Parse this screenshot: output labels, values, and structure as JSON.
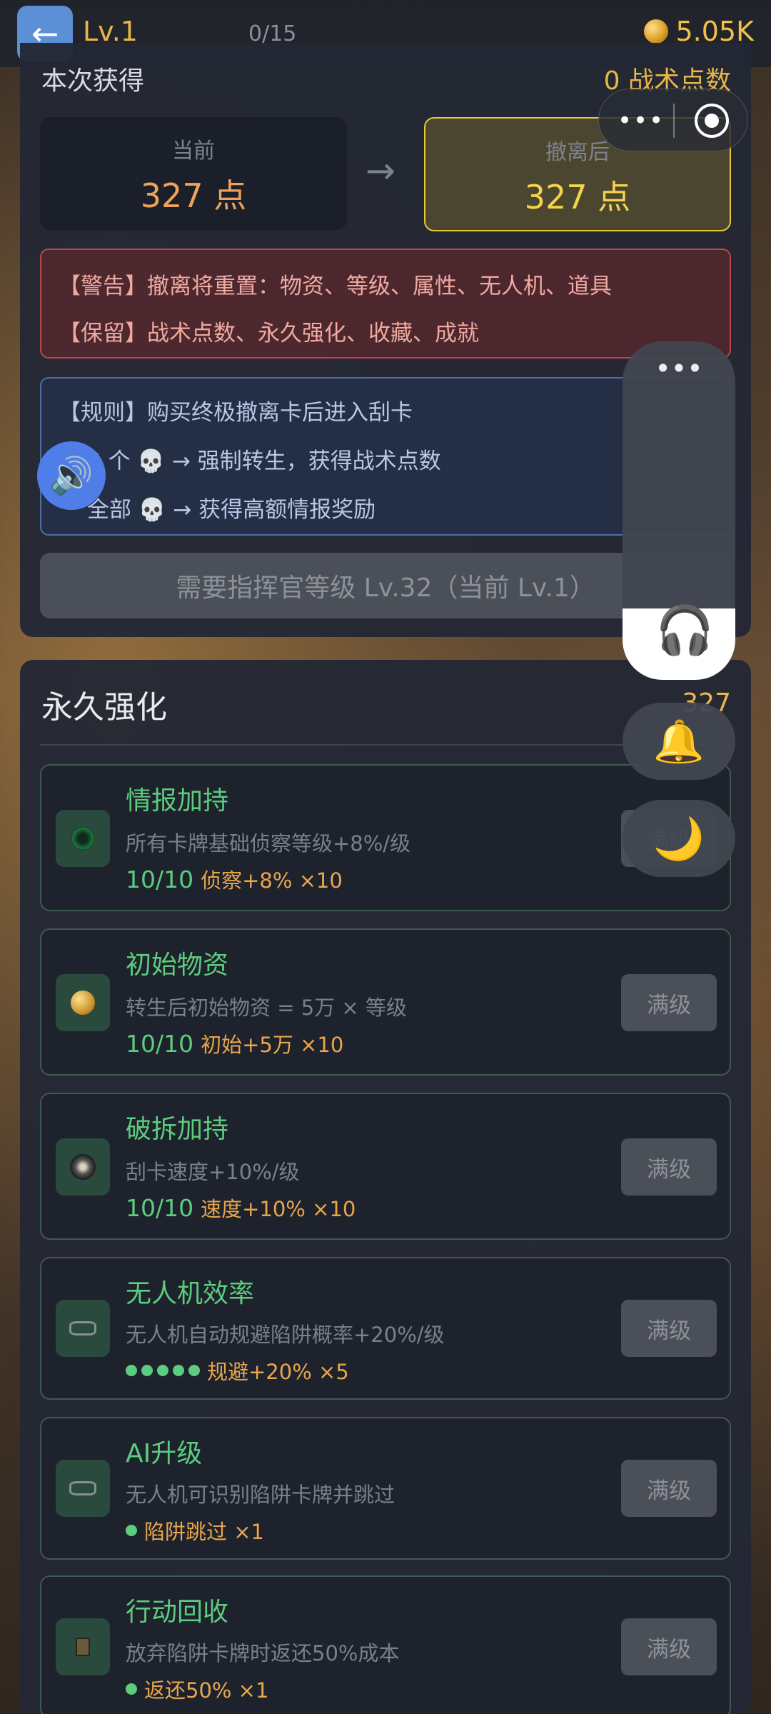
{
  "topbar": {
    "back_icon": "arrow-left-icon",
    "level": "Lv.1",
    "progress": "0/15",
    "coins": "5.05K"
  },
  "extract": {
    "gained_label": "本次获得",
    "gained_value": "0 战术点数",
    "current_label": "当前",
    "current_value": "327 点",
    "after_label": "撤离后",
    "after_value": "327 点",
    "warn_line1": "【警告】撤离将重置：物资、等级、属性、无人机、道具",
    "warn_line2": "【保留】战术点数、永久强化、收藏、成就",
    "rules_line1": "【规则】购买终极撤离卡后进入刮卡",
    "rules_line2": "3 个 💀 → 强制转生，获得战术点数",
    "rules_line3": "全部 💀 → 获得高额情报奖励",
    "require_button": "需要指挥官等级 Lv.32（当前 Lv.1）"
  },
  "permanent": {
    "title": "永久强化",
    "points": "327",
    "cards": [
      {
        "name": "情报加持",
        "desc": "所有卡牌基础侦察等级+8%/级",
        "level": "10/10",
        "effect": "侦察+8% ×10",
        "button": "满级",
        "icon": "radar-icon"
      },
      {
        "name": "初始物资",
        "desc": "转生后初始物资 = 5万 × 等级",
        "level": "10/10",
        "effect": "初始+5万 ×10",
        "button": "满级",
        "icon": "coin-icon"
      },
      {
        "name": "破拆加持",
        "desc": "刮卡速度+10%/级",
        "level": "10/10",
        "effect": "速度+10% ×10",
        "button": "满级",
        "icon": "break-icon"
      },
      {
        "name": "无人机效率",
        "desc": "无人机自动规避陷阱概率+20%/级",
        "dots": 5,
        "effect": "规避+20% ×5",
        "button": "满级",
        "icon": "drone-icon"
      },
      {
        "name": "AI升级",
        "desc": "无人机可识别陷阱卡牌并跳过",
        "dots": 1,
        "effect": "陷阱跳过 ×1",
        "button": "满级",
        "icon": "drone-icon"
      },
      {
        "name": "行动回收",
        "desc": "放弃陷阱卡牌时返还50%成本",
        "dots": 1,
        "effect": "返还50% ×1",
        "button": "满级",
        "icon": "box-icon"
      }
    ]
  },
  "overlays": {
    "menu_dots": "•••",
    "side_dots": "•••"
  }
}
